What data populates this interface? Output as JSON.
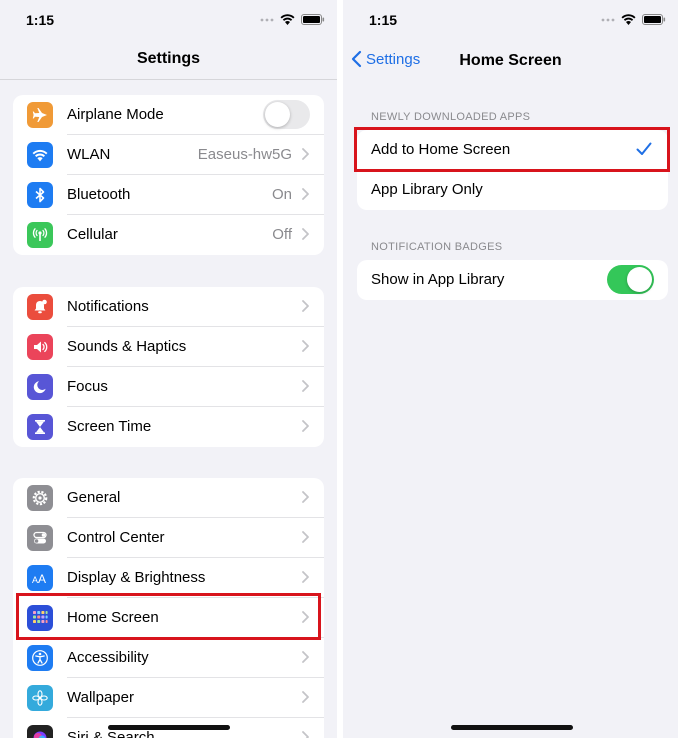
{
  "left": {
    "status": {
      "time": "1:15"
    },
    "title": "Settings",
    "groups": [
      [
        {
          "label": "Airplane Mode",
          "control": "toggle",
          "toggle_on": false,
          "icon": "airplane-icon",
          "color": "#f09a37"
        },
        {
          "label": "WLAN",
          "value": "Easeus-hw5G",
          "icon": "wifi-icon",
          "color": "#1e7cf2"
        },
        {
          "label": "Bluetooth",
          "value": "On",
          "icon": "bluetooth-icon",
          "color": "#1e7cf2"
        },
        {
          "label": "Cellular",
          "value": "Off",
          "icon": "cellular-icon",
          "color": "#3bc75a"
        }
      ],
      [
        {
          "label": "Notifications",
          "icon": "notifications-icon",
          "color": "#eb4d3d"
        },
        {
          "label": "Sounds & Haptics",
          "icon": "speaker-icon",
          "color": "#eb445a"
        },
        {
          "label": "Focus",
          "icon": "moon-icon",
          "color": "#5856d6"
        },
        {
          "label": "Screen Time",
          "icon": "hourglass-icon",
          "color": "#5856d6"
        }
      ],
      [
        {
          "label": "General",
          "icon": "gear-icon",
          "color": "#8e8e93"
        },
        {
          "label": "Control Center",
          "icon": "switches-icon",
          "color": "#8e8e93"
        },
        {
          "label": "Display & Brightness",
          "icon": "text-size-icon",
          "color": "#1e7cf2"
        },
        {
          "label": "Home Screen",
          "icon": "home-grid-icon",
          "color": "#2c4fd8",
          "highlighted": true
        },
        {
          "label": "Accessibility",
          "icon": "accessibility-icon",
          "color": "#1e7cf2"
        },
        {
          "label": "Wallpaper",
          "icon": "flower-icon",
          "color": "#34aadc"
        },
        {
          "label": "Siri & Search",
          "icon": "siri-icon",
          "color": "#222222"
        }
      ]
    ]
  },
  "right": {
    "status": {
      "time": "1:15"
    },
    "back_label": "Settings",
    "title": "Home Screen",
    "sections": [
      {
        "header": "NEWLY DOWNLOADED APPS",
        "rows": [
          {
            "label": "Add to Home Screen",
            "checked": true,
            "highlighted": true
          },
          {
            "label": "App Library Only",
            "checked": false
          }
        ]
      },
      {
        "header": "NOTIFICATION BADGES",
        "rows": [
          {
            "label": "Show in App Library",
            "control": "toggle",
            "toggle_on": true
          }
        ]
      }
    ]
  },
  "colors": {
    "accent": "#1f6fe5",
    "highlight_box": "#d8141c",
    "toggle_on": "#34c759"
  }
}
